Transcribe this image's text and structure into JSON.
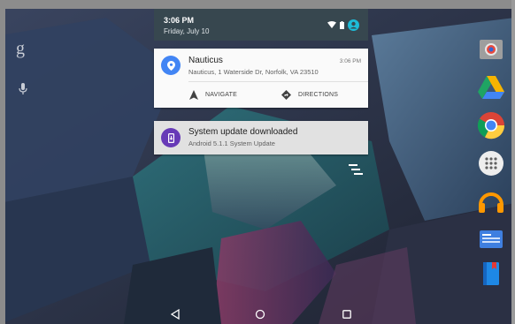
{
  "status_bar": {
    "time": "3:06 PM",
    "date": "Friday, July 10"
  },
  "notifications": [
    {
      "title": "Nauticus",
      "text": "Nauticus, 1 Waterside Dr, Norfolk, VA 23510",
      "time": "3:06 PM",
      "icon": "location-pin-icon",
      "actions": [
        {
          "label": "NAVIGATE",
          "icon": "navigation-arrow-icon"
        },
        {
          "label": "DIRECTIONS",
          "icon": "directions-icon"
        }
      ]
    },
    {
      "title": "System update downloaded",
      "text": "Android 5.1.1 System Update",
      "icon": "system-update-icon"
    }
  ],
  "left_shortcuts": [
    {
      "icon": "google-search-icon",
      "glyph": "g"
    },
    {
      "icon": "microphone-icon"
    }
  ],
  "dock_apps": [
    {
      "icon": "camera-app-icon"
    },
    {
      "icon": "google-drive-icon"
    },
    {
      "icon": "chrome-icon"
    },
    {
      "icon": "app-drawer-icon"
    },
    {
      "icon": "headphones-app-icon"
    },
    {
      "icon": "news-app-icon"
    },
    {
      "icon": "book-app-icon"
    }
  ],
  "nav_bar": [
    "back-icon",
    "home-icon",
    "recents-icon"
  ],
  "colors": {
    "shade_header": "#37474f",
    "maps_blue": "#4285f4",
    "update_purple": "#673ab7"
  }
}
